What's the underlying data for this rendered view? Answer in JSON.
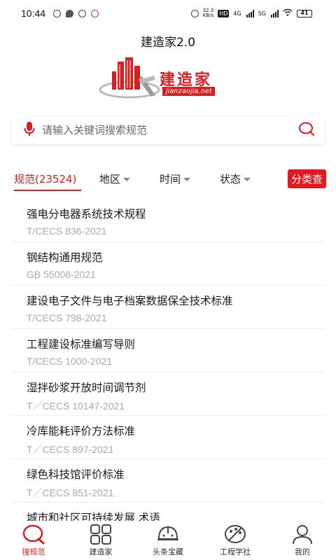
{
  "status": {
    "time": "10:44",
    "net_speed_top": "32.3",
    "net_speed_bottom": "KB/s",
    "hd": "HD",
    "sig1": "4G",
    "sig2": "5G",
    "battery": "41"
  },
  "app": {
    "title": "建造家2.0",
    "logo_text": "建造家",
    "logo_domain": "jianzaojia.net"
  },
  "search": {
    "placeholder": "请输入关键词搜索规范"
  },
  "filters": {
    "tabs": [
      "规范(23524)",
      "地区",
      "时间",
      "状态"
    ],
    "category_button": "分类查"
  },
  "items": [
    {
      "title": "强电分电器系统技术规程",
      "code": "T/CECS 836-2021"
    },
    {
      "title": "钢结构通用规范",
      "code": "GB 55006-2021"
    },
    {
      "title": "建设电子文件与电子档案数据保全技术标准",
      "code": "T/CECS 798-2021"
    },
    {
      "title": "工程建设标准编写导则",
      "code": "T/CECS 1000-2021"
    },
    {
      "title": "湿拌砂浆开放时间调节剂",
      "code": "T／CECS 10147-2021"
    },
    {
      "title": "冷库能耗评价方法标准",
      "code": "T／CECS 897-2021"
    },
    {
      "title": "绿色科技馆评价标准",
      "code": "T／CECS 851-2021"
    }
  ],
  "partial_item": "城市和社区可持续发展 术语",
  "nav": [
    {
      "label": "搜规范",
      "icon": "search-icon"
    },
    {
      "label": "建造家",
      "icon": "grid-icon"
    },
    {
      "label": "头条宝藏",
      "icon": "helmet-icon"
    },
    {
      "label": "工程学社",
      "icon": "palette-icon"
    },
    {
      "label": "我的",
      "icon": "user-icon"
    }
  ],
  "colors": {
    "accent": "#d81e1e",
    "muted": "#aaaaaa"
  }
}
